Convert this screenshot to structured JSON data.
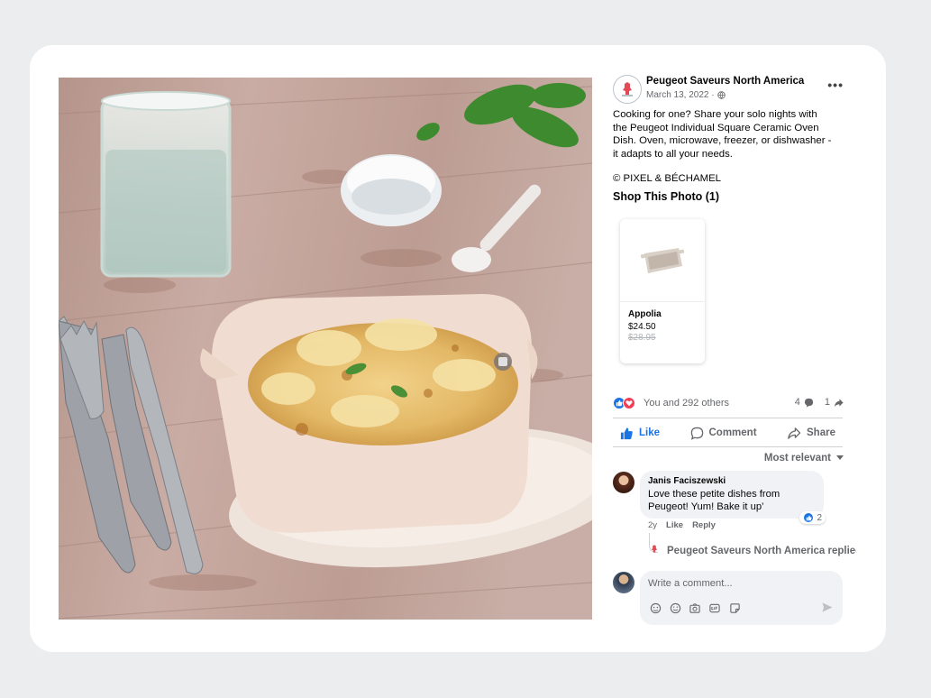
{
  "post": {
    "page_name": "Peugeot Saveurs North America",
    "date": "March 13, 2022 ·",
    "more_label": "•••",
    "caption": "Cooking for one? Share your solo nights with\nthe Peugeot Individual Square Ceramic Oven\nDish. Oven, microwave, freezer, or dishwasher -\nit adapts to all your needs.",
    "credit": "© PIXEL & BÉCHAMEL",
    "shop_title": "Shop This Photo (1)"
  },
  "product": {
    "name": "Appolia",
    "price": "$24.50",
    "old_price": "$28.95"
  },
  "engagement": {
    "reactions_text": "You and 292 others",
    "comment_count": "4",
    "share_count": "1"
  },
  "actions": {
    "like": "Like",
    "comment": "Comment",
    "share": "Share"
  },
  "sort_label": "Most relevant",
  "comment": {
    "author": "Janis Faciszewski",
    "text": "Love these petite dishes from Peugeot! Yum! Bake it up’",
    "likes": "2",
    "age": "2y",
    "like_label": "Like",
    "reply_label": "Reply"
  },
  "reply_preview": "Peugeot Saveurs North America replied",
  "composer": {
    "placeholder": "Write a comment..."
  },
  "colors": {
    "facebook_blue": "#1b74e4",
    "love_red": "#f33e58",
    "secondary_text": "#65676b"
  },
  "icons": [
    "more-icon",
    "globe-icon",
    "like-icon",
    "love-icon",
    "comment-icon",
    "share-icon",
    "caret-down-icon",
    "avatar-sticker-icon",
    "emoji-icon",
    "camera-icon",
    "gif-icon",
    "sticker-icon",
    "send-icon",
    "tag-icon"
  ]
}
